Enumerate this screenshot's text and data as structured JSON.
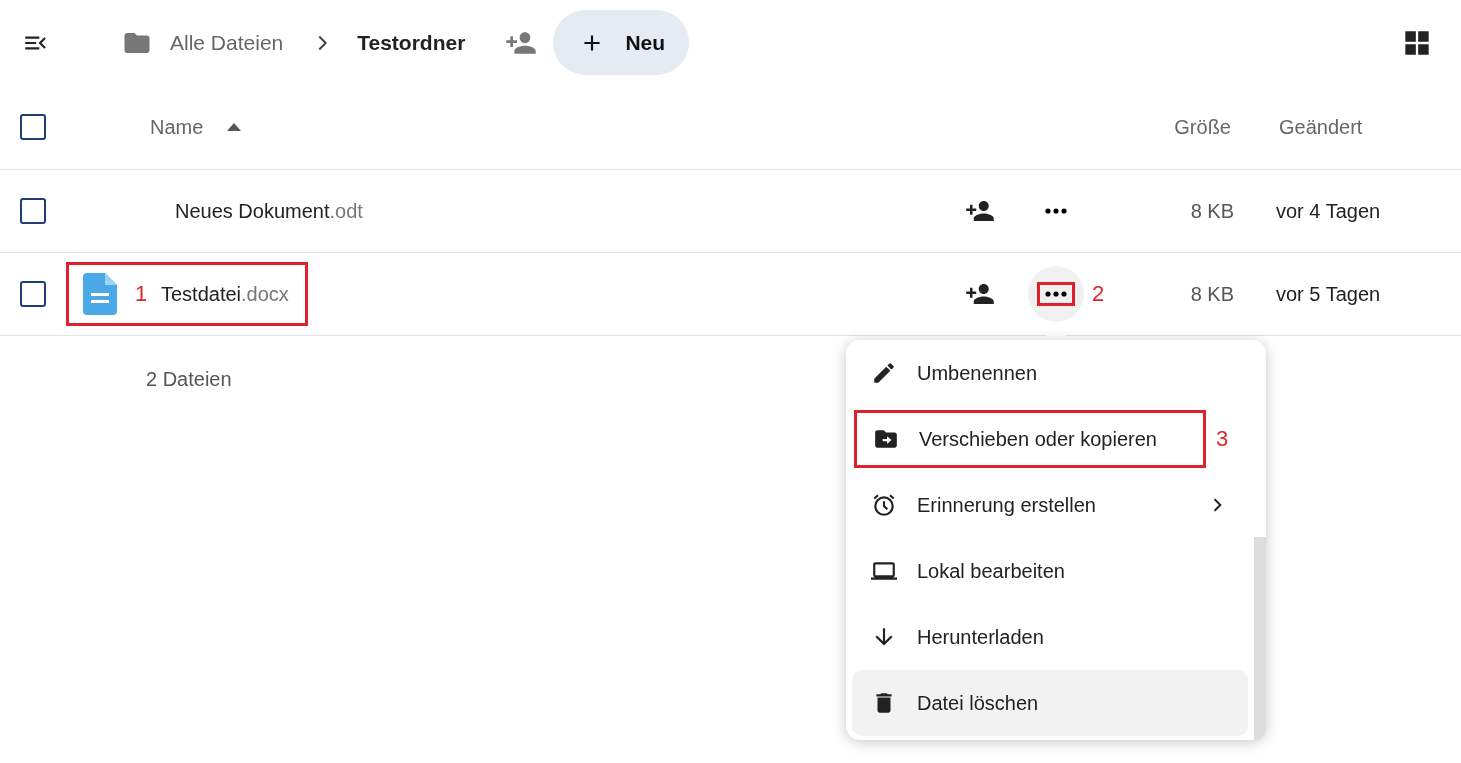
{
  "header": {
    "breadcrumbs": [
      {
        "label": "Alle Dateien",
        "current": false
      },
      {
        "label": "Testordner",
        "current": true
      }
    ],
    "new_button": "Neu"
  },
  "table": {
    "select_all_checked": false,
    "columns": [
      {
        "label": "Name",
        "sorted": true
      },
      {
        "label": "Größe"
      },
      {
        "label": "Geändert"
      }
    ],
    "rows": [
      {
        "name": "Neues Dokument",
        "extension": ".odt",
        "size": "8 KB",
        "modified": "vor 4 Tagen",
        "checked": false,
        "has_icon": false,
        "menu_open": false
      },
      {
        "name": "Testdatei",
        "extension": ".docx",
        "size": "8 KB",
        "modified": "vor 5 Tagen",
        "checked": false,
        "has_icon": true,
        "callout": "1",
        "actions_callout": "2",
        "menu_open": true
      }
    ],
    "summary": "2 Dateien"
  },
  "context_menu": {
    "items": [
      {
        "label": "Umbenennen",
        "submenu": false,
        "hovered": false
      },
      {
        "label": "Verschieben oder kopieren",
        "submenu": false,
        "hovered": false,
        "callout": "3"
      },
      {
        "label": "Erinnerung erstellen",
        "submenu": true,
        "hovered": false
      },
      {
        "label": "Lokal bearbeiten",
        "submenu": false,
        "hovered": false
      },
      {
        "label": "Herunterladen",
        "submenu": false,
        "hovered": false
      },
      {
        "label": "Datei löschen",
        "submenu": false,
        "hovered": true
      }
    ]
  }
}
